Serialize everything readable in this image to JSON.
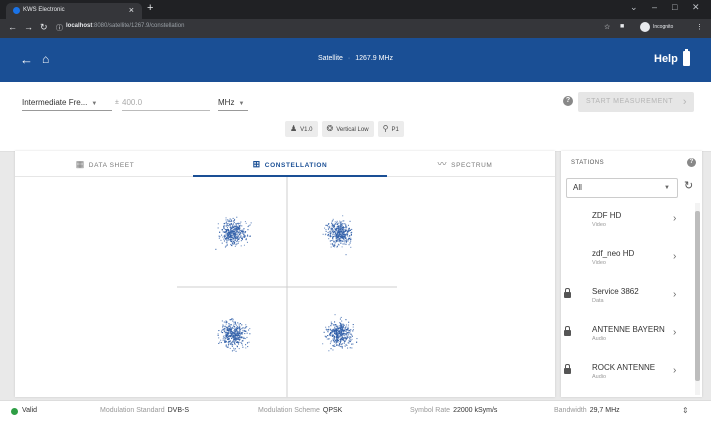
{
  "browser": {
    "tab_title": "KWS Electronic",
    "tab_close": "×",
    "new_tab": "+",
    "url_host": "localhost",
    "url_path": ":8080/satellite/1267.9/constellation",
    "incognito_label": "Incognito"
  },
  "header": {
    "section": "Satellite",
    "frequency": "1267.9 MHz",
    "help_label": "Help"
  },
  "settings": {
    "band_select": "Intermediate Fre...",
    "plus_minus": "±",
    "frequency_placeholder": "400.0",
    "unit_select": "MHz",
    "start_label": "START MEASUREMENT",
    "chips": {
      "voltage": "V1.0",
      "polarization": "Vertical Low",
      "port": "P1"
    }
  },
  "tabs": {
    "data_sheet": "DATA SHEET",
    "constellation": "CONSTELLATION",
    "spectrum": "SPECTRUM"
  },
  "constellation": {
    "scheme": "QPSK",
    "point_color": "#2f5ea8"
  },
  "stations": {
    "title": "STATIONS",
    "filter": "All",
    "items": [
      {
        "name": "ZDF HD",
        "type": "Video",
        "locked": false
      },
      {
        "name": "zdf_neo HD",
        "type": "Video",
        "locked": false
      },
      {
        "name": "Service 3862",
        "type": "Data",
        "locked": true
      },
      {
        "name": "ANTENNE BAYERN",
        "type": "Audio",
        "locked": true
      },
      {
        "name": "ROCK ANTENNE",
        "type": "Audio",
        "locked": true
      }
    ]
  },
  "status": {
    "valid": "Valid",
    "modulation_standard_label": "Modulation Standard",
    "modulation_standard_value": "DVB-S",
    "modulation_scheme_label": "Modulation Scheme",
    "modulation_scheme_value": "QPSK",
    "symbol_rate_label": "Symbol Rate",
    "symbol_rate_value": "22000 kSym/s",
    "bandwidth_label": "Bandwidth",
    "bandwidth_value": "29,7 MHz"
  },
  "colors": {
    "brand": "#1a4f95",
    "valid": "#2e9e45"
  }
}
